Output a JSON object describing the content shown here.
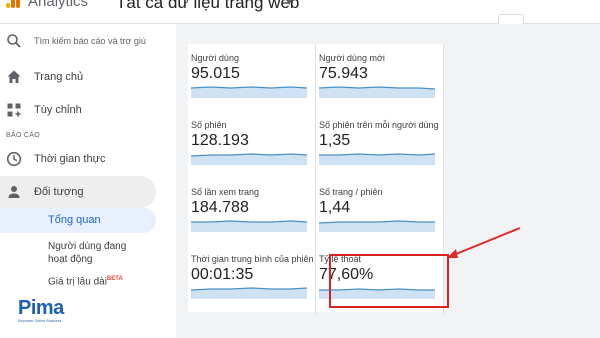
{
  "header": {
    "app_name": "Analytics",
    "property_name": "Tất cả dữ liệu trang web",
    "logo_colors": [
      "#f9ab00",
      "#e37400",
      "#e37400"
    ]
  },
  "sidebar": {
    "search_placeholder": "Tìm kiếm báo cáo và trợ giú",
    "nav_items": [
      {
        "label": "Trang chủ",
        "icon": "home-icon"
      },
      {
        "label": "Tùy chỉnh",
        "icon": "customize-icon"
      }
    ],
    "section_label": "BÁO CÁO",
    "reports": [
      {
        "label": "Thời gian thực",
        "icon": "clock-icon"
      },
      {
        "label": "Đối tượng",
        "icon": "person-icon"
      }
    ],
    "sub_items": {
      "overview": "Tổng quan",
      "active_users_line1": "Người dùng đang",
      "active_users_line2": "hoạt động",
      "lifetime_value": "Giá trị lâu dài",
      "beta": "BETA"
    }
  },
  "metrics": [
    {
      "title": "Người dùng",
      "value": "95.015"
    },
    {
      "title": "Người dùng mới",
      "value": "75.943"
    },
    {
      "title": "Số phiên",
      "value": "128.193"
    },
    {
      "title": "Số phiên trên mỗi người dùng",
      "value": "1,35"
    },
    {
      "title": "Số lần xem trang",
      "value": "184.788"
    },
    {
      "title": "Số trang / phiên",
      "value": "1,44"
    },
    {
      "title": "Thời gian trung bình của phiên",
      "value": "00:01:35"
    },
    {
      "title": "Tỷ lệ thoát",
      "value": "77,60%"
    }
  ],
  "brand": {
    "name": "Pima",
    "tagline": "Empower Online Business"
  },
  "colors": {
    "accent": "#1967d2",
    "sparkline": "#4a90c8",
    "highlight": "#d92323"
  }
}
